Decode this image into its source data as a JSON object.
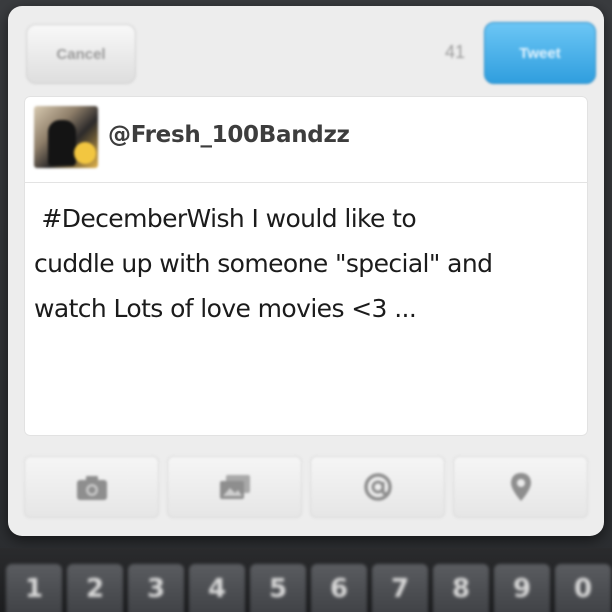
{
  "compose": {
    "cancel_label": "Cancel",
    "char_count": "41",
    "tweet_label": "Tweet",
    "handle": "@Fresh_100Bandzz",
    "text": " #DecemberWish I would like to\ncuddle up with someone \"special\" and\nwatch Lots of love movies <3 ..."
  },
  "toolbar": {
    "items": [
      {
        "icon": "camera-icon"
      },
      {
        "icon": "gallery-icon"
      },
      {
        "icon": "at-mention-icon"
      },
      {
        "icon": "location-pin-icon"
      }
    ]
  },
  "keyboard": {
    "keys": [
      "1",
      "2",
      "3",
      "4",
      "5",
      "6",
      "7",
      "8",
      "9",
      "0"
    ]
  },
  "colors": {
    "accent": "#2f9ede",
    "background": "#2b2d30",
    "dialog": "#ededed"
  }
}
